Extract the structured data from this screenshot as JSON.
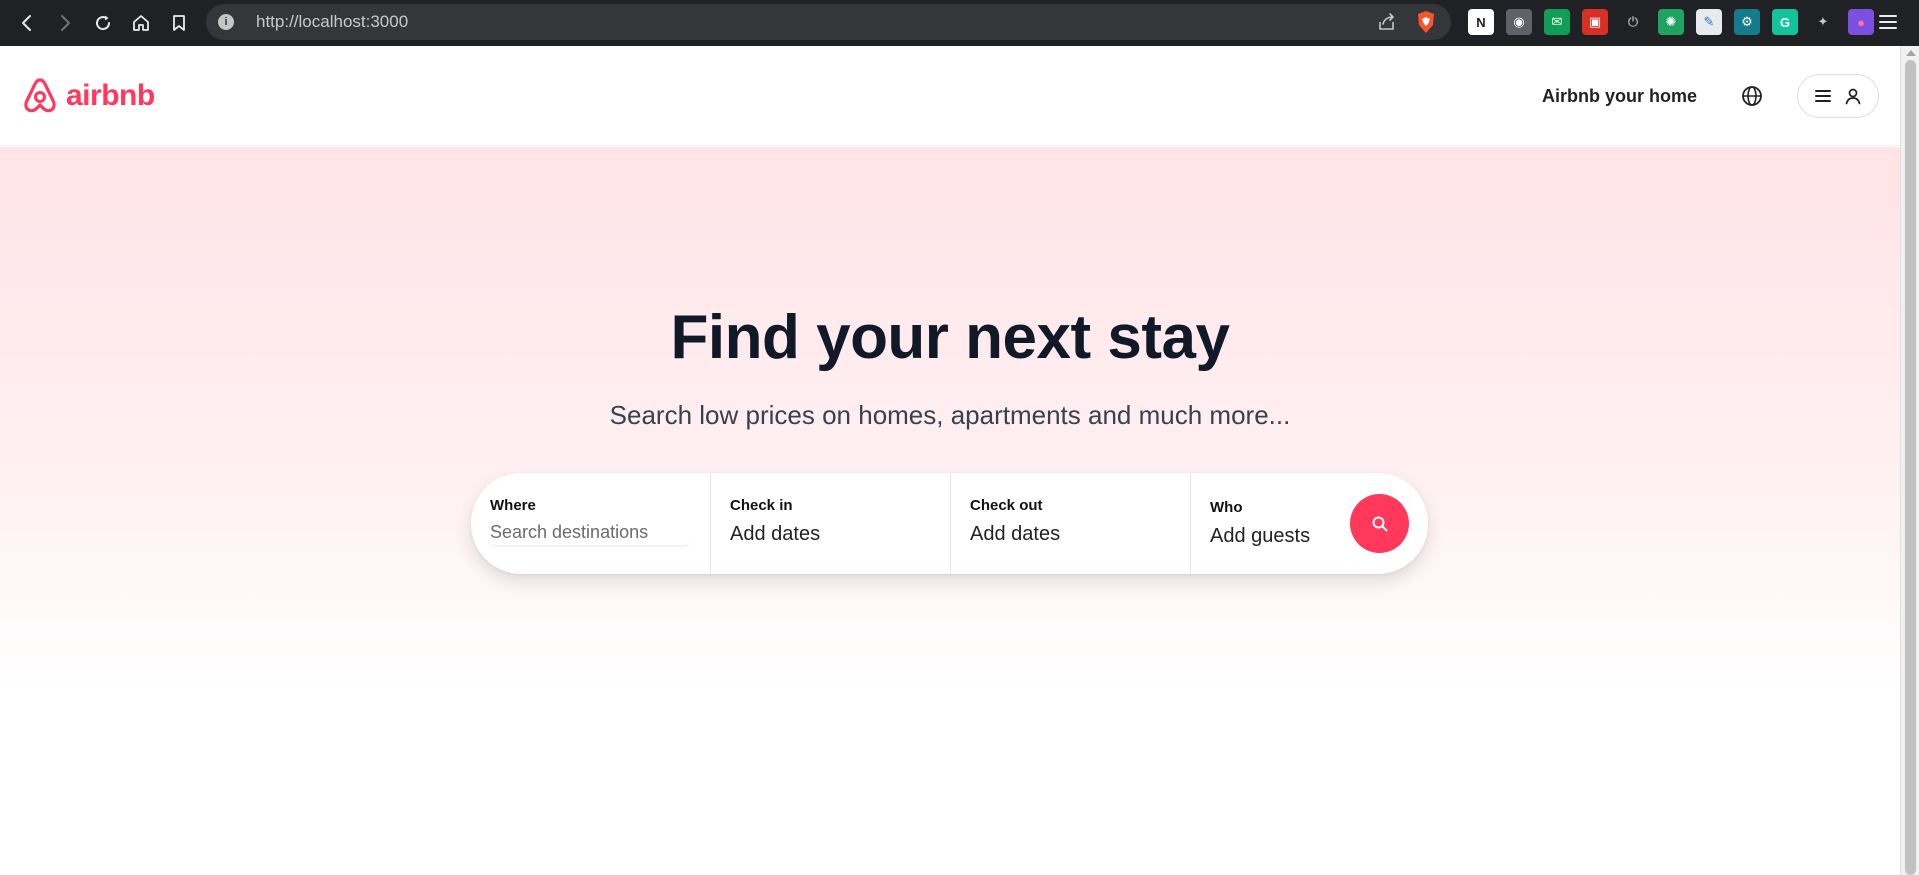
{
  "browser": {
    "url": "http://localhost:3000",
    "nav_icons": [
      "back-icon",
      "forward-icon",
      "reload-icon",
      "home-icon",
      "bookmark-icon"
    ],
    "extensions": [
      {
        "name": "notion-extension-icon",
        "glyph": "N",
        "bg": "#ffffff",
        "fg": "#202124"
      },
      {
        "name": "camera-extension-icon",
        "glyph": "◉",
        "bg": "#5f6368",
        "fg": "#ffffff"
      },
      {
        "name": "mail-extension-icon",
        "glyph": "✉",
        "bg": "#0f9d58",
        "fg": "#ffffff"
      },
      {
        "name": "red-extension-icon",
        "glyph": "▣",
        "bg": "#d93025",
        "fg": "#ffffff"
      },
      {
        "name": "power-extension-icon",
        "glyph": "⏻",
        "bg": "transparent",
        "fg": "#9aa0a6"
      },
      {
        "name": "audio-extension-icon",
        "glyph": "✺",
        "bg": "#1ea362",
        "fg": "#ffffff"
      },
      {
        "name": "pen-extension-icon",
        "glyph": "✎",
        "bg": "#e8eaed",
        "fg": "#1a73e8"
      },
      {
        "name": "teal-extension-icon",
        "glyph": "⚙",
        "bg": "#137b8b",
        "fg": "#ffffff"
      },
      {
        "name": "grammarly-extension-icon",
        "glyph": "G",
        "bg": "#15c39a",
        "fg": "#ffffff"
      },
      {
        "name": "puzzle-extensions-icon",
        "glyph": "✦",
        "bg": "transparent",
        "fg": "#c4c7c5"
      },
      {
        "name": "profile-avatar-icon",
        "glyph": "●",
        "bg": "#7b4fe0",
        "fg": "#ff6fa8"
      }
    ]
  },
  "header": {
    "brand": "airbnb",
    "host_link": "Airbnb your home"
  },
  "hero": {
    "title": "Find your next stay",
    "subtitle": "Search low prices on homes, apartments and much more..."
  },
  "search": {
    "where_label": "Where",
    "where_placeholder": "Search destinations",
    "checkin_label": "Check in",
    "checkin_value": "Add dates",
    "checkout_label": "Check out",
    "checkout_value": "Add dates",
    "who_label": "Who",
    "who_value": "Add guests"
  },
  "colors": {
    "brand": "#ff385c",
    "heading": "#111827",
    "chrome_bg": "#202124"
  }
}
